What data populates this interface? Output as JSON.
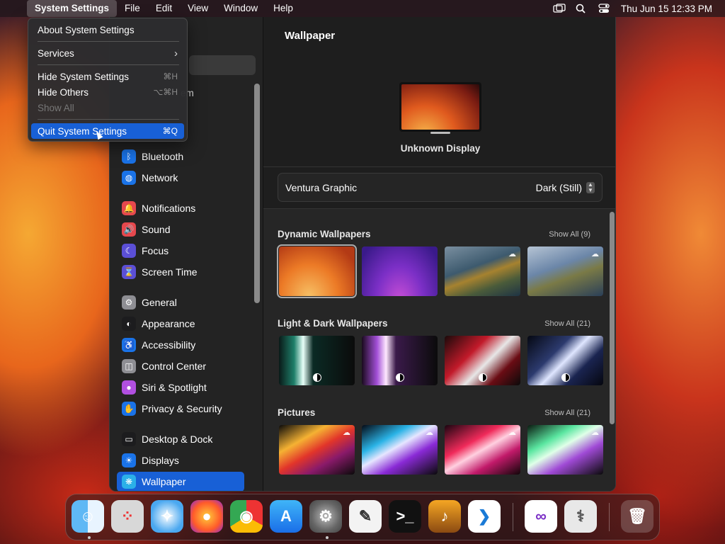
{
  "menubar": {
    "apple": "",
    "items": [
      "System Settings",
      "File",
      "Edit",
      "View",
      "Window",
      "Help"
    ],
    "datetime": "Thu Jun 15  12:33 PM"
  },
  "app_menu": {
    "about": "About System Settings",
    "services": "Services",
    "hide": {
      "label": "Hide System Settings",
      "shortcut": "⌘H"
    },
    "hide_others": {
      "label": "Hide Others",
      "shortcut": "⌥⌘H"
    },
    "show_all": "Show All",
    "quit": {
      "label": "Quit System Settings",
      "shortcut": "⌘Q"
    }
  },
  "sidebar": {
    "partial_label": "em",
    "items": [
      {
        "label": "Bluetooth",
        "icon": "bluetooth-icon",
        "color": "#1a73e8"
      },
      {
        "label": "Network",
        "icon": "globe-icon",
        "color": "#1a73e8"
      },
      {
        "label": "Notifications",
        "icon": "bell-icon",
        "color": "#e5484d"
      },
      {
        "label": "Sound",
        "icon": "speaker-icon",
        "color": "#e5484d"
      },
      {
        "label": "Focus",
        "icon": "moon-icon",
        "color": "#5b4fd6"
      },
      {
        "label": "Screen Time",
        "icon": "hourglass-icon",
        "color": "#5b4fd6"
      },
      {
        "label": "General",
        "icon": "gear-icon",
        "color": "#8e8e93"
      },
      {
        "label": "Appearance",
        "icon": "appearance-icon",
        "color": "#1c1c1e"
      },
      {
        "label": "Accessibility",
        "icon": "accessibility-icon",
        "color": "#1a73e8"
      },
      {
        "label": "Control Center",
        "icon": "control-center-icon",
        "color": "#8e8e93"
      },
      {
        "label": "Siri & Spotlight",
        "icon": "siri-icon",
        "color": "#b14fe0"
      },
      {
        "label": "Privacy & Security",
        "icon": "hand-icon",
        "color": "#1a73e8"
      },
      {
        "label": "Desktop & Dock",
        "icon": "dock-icon",
        "color": "#1c1c1e"
      },
      {
        "label": "Displays",
        "icon": "sun-icon",
        "color": "#1a73e8"
      },
      {
        "label": "Wallpaper",
        "icon": "wallpaper-icon",
        "color": "#2bb0e8"
      }
    ]
  },
  "main": {
    "title": "Wallpaper",
    "display_name": "Unknown Display",
    "current_wallpaper": "Ventura Graphic",
    "mode": "Dark (Still)",
    "sections": [
      {
        "title": "Dynamic Wallpapers",
        "show_all": "Show All (9)"
      },
      {
        "title": "Light & Dark Wallpapers",
        "show_all": "Show All (21)"
      },
      {
        "title": "Pictures",
        "show_all": "Show All (21)"
      }
    ]
  },
  "dock": {
    "apps": [
      "Finder",
      "Launchpad",
      "Safari",
      "Firefox",
      "Chrome",
      "App Store",
      "System Settings",
      "TextEdit",
      "Terminal",
      "GarageBand",
      "Visual Studio Code",
      "Visual Studio",
      "Disk Utility",
      "Trash"
    ]
  }
}
